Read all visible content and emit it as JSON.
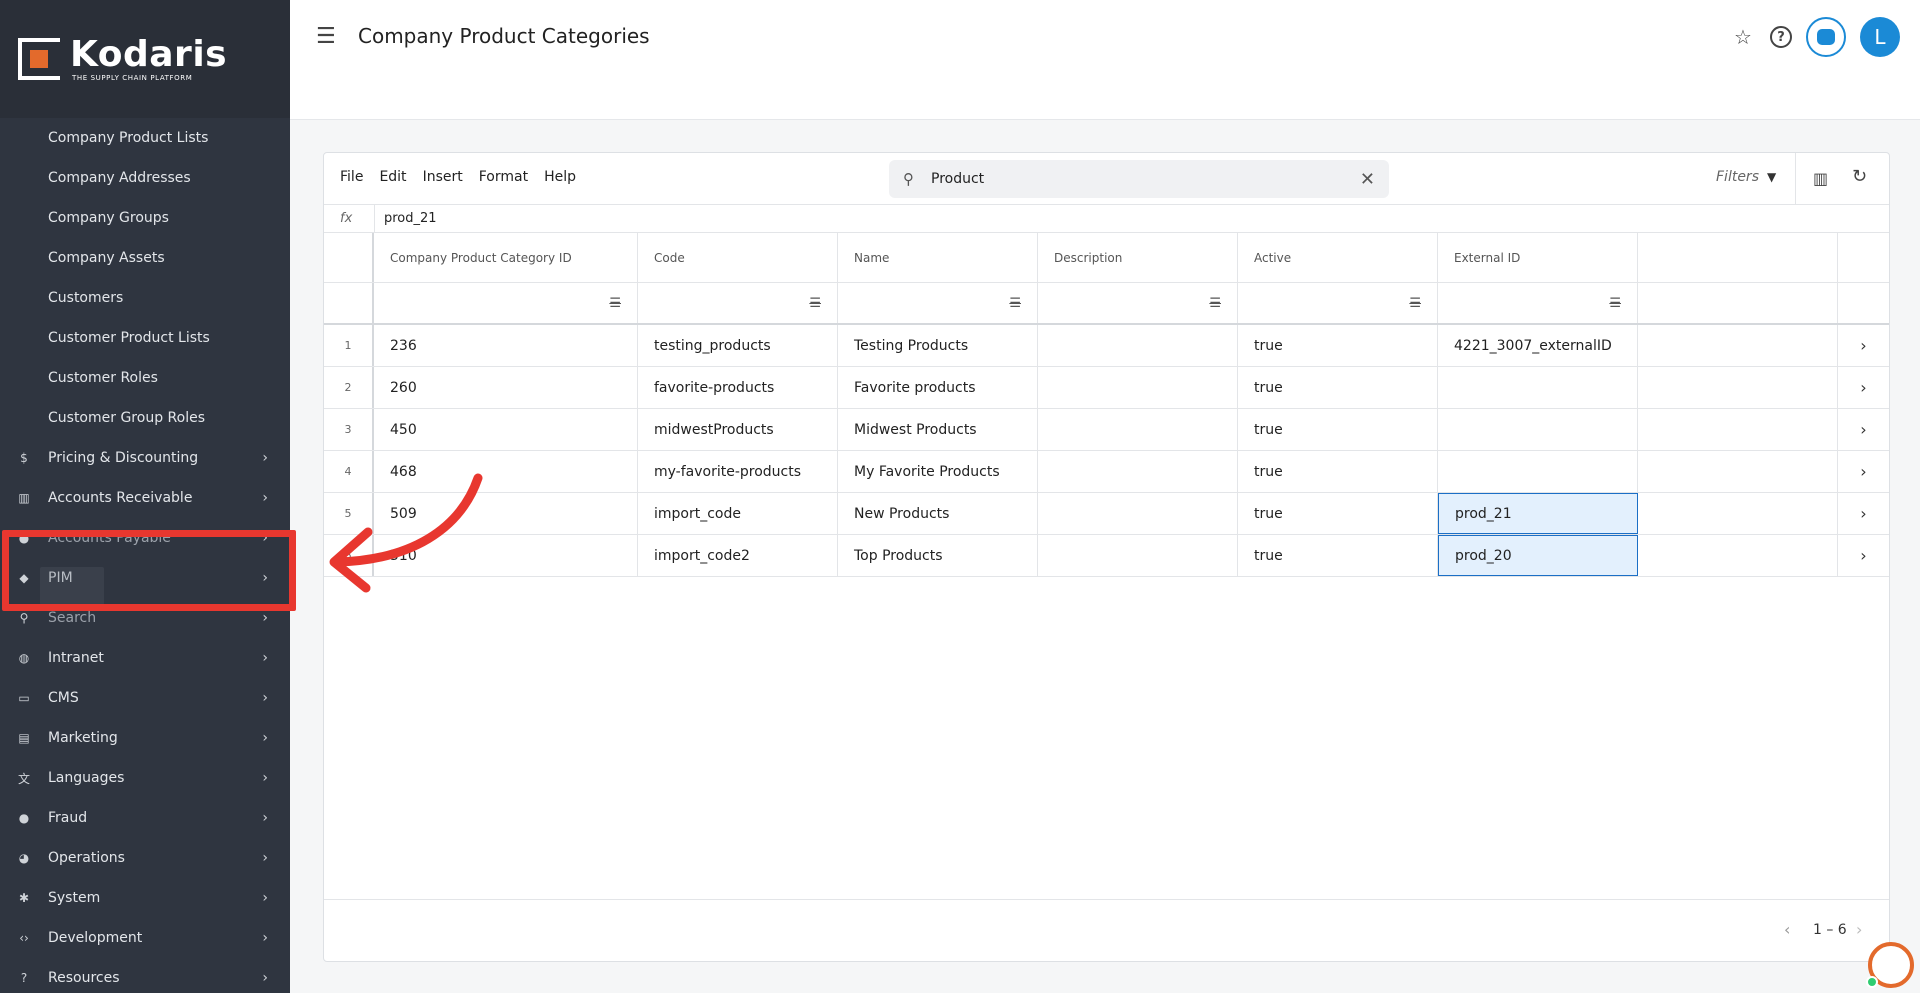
{
  "brand": {
    "name": "Kodaris",
    "tagline": "THE SUPPLY CHAIN PLATFORM"
  },
  "sidebar": {
    "sub_items": [
      "Company Product Lists",
      "Company Addresses",
      "Company Groups",
      "Company Assets",
      "Customers",
      "Customer Product Lists",
      "Customer Roles",
      "Customer Group Roles"
    ],
    "sections": [
      {
        "label": "Pricing & Discounting",
        "icon": "dollar-icon"
      },
      {
        "label": "Accounts Receivable",
        "icon": "bank-icon"
      },
      {
        "label": "Accounts Payable",
        "icon": "payable-icon"
      },
      {
        "label": "PIM",
        "icon": "tag-icon"
      },
      {
        "label": "Search",
        "icon": "search-icon"
      },
      {
        "label": "Intranet",
        "icon": "globe-icon"
      },
      {
        "label": "CMS",
        "icon": "cms-icon"
      },
      {
        "label": "Marketing",
        "icon": "marketing-icon"
      },
      {
        "label": "Languages",
        "icon": "translate-icon"
      },
      {
        "label": "Fraud",
        "icon": "alert-icon"
      },
      {
        "label": "Operations",
        "icon": "operations-icon"
      },
      {
        "label": "System",
        "icon": "gear-icon"
      },
      {
        "label": "Development",
        "icon": "code-icon"
      },
      {
        "label": "Resources",
        "icon": "help-icon"
      }
    ]
  },
  "header": {
    "title": "Company Product Categories",
    "avatar_initial": "L"
  },
  "toolbar": {
    "menus": [
      "File",
      "Edit",
      "Insert",
      "Format",
      "Help"
    ],
    "search_value": "Product",
    "filters_label": "Filters"
  },
  "formula": {
    "label": "fx",
    "value": "prod_21"
  },
  "table": {
    "columns": [
      "Company Product Category ID",
      "Code",
      "Name",
      "Description",
      "Active",
      "External ID",
      ""
    ],
    "rows": [
      {
        "n": "1",
        "id": "236",
        "code": "testing_products",
        "name": "Testing Products",
        "description": "",
        "active": "true",
        "external_id": "4221_3007_externalID"
      },
      {
        "n": "2",
        "id": "260",
        "code": "favorite-products",
        "name": "Favorite products",
        "description": "",
        "active": "true",
        "external_id": ""
      },
      {
        "n": "3",
        "id": "450",
        "code": "midwestProducts",
        "name": "Midwest Products",
        "description": "",
        "active": "true",
        "external_id": ""
      },
      {
        "n": "4",
        "id": "468",
        "code": "my-favorite-products",
        "name": "My Favorite Products",
        "description": "",
        "active": "true",
        "external_id": ""
      },
      {
        "n": "5",
        "id": "509",
        "code": "import_code",
        "name": "New Products",
        "description": "",
        "active": "true",
        "external_id": "prod_21"
      },
      {
        "n": "6",
        "id": "510",
        "code": "import_code2",
        "name": "Top Products",
        "description": "",
        "active": "true",
        "external_id": "prod_20"
      }
    ]
  },
  "pager": {
    "range": "1 – 6"
  },
  "colors": {
    "accent": "#1b8ad6",
    "sidebar_bg": "#2f3540",
    "annotation": "#e8372f",
    "brand_orange": "#e36a2c"
  }
}
